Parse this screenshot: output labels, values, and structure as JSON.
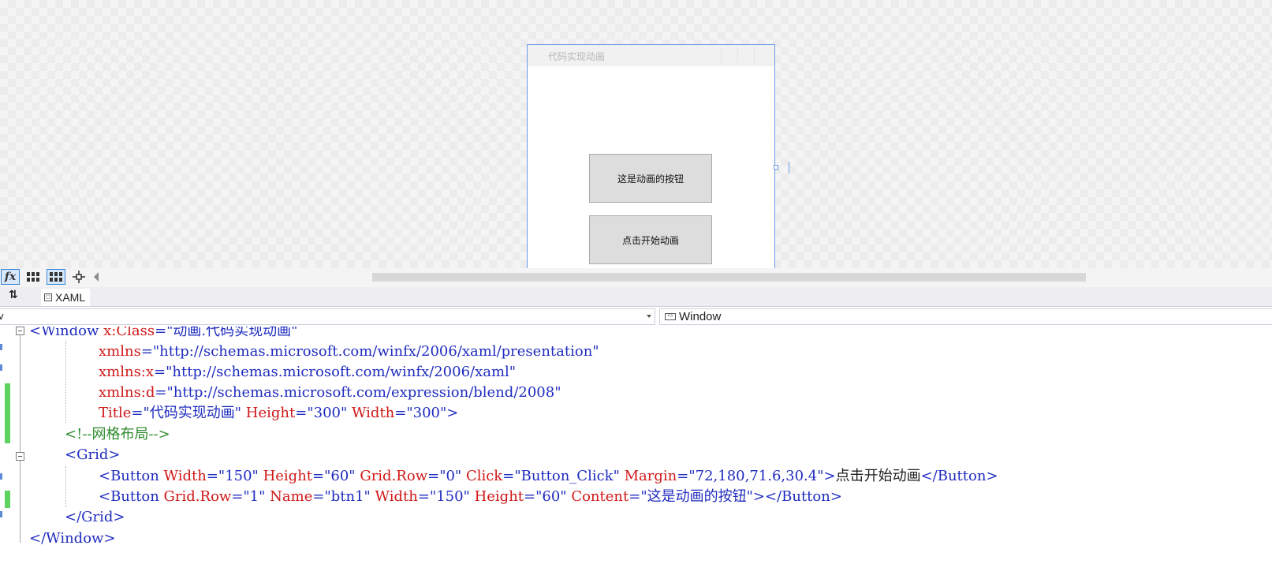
{
  "designer": {
    "window_title": "代码实现动画",
    "button_top_label": "这是动画的按钮",
    "button_bottom_label": "点击开始动画"
  },
  "zoombar": {
    "fx_label": "fx"
  },
  "tabs": {
    "swap_symbol": "⇅",
    "xaml_label": "XAML"
  },
  "navbar": {
    "left_value": "v",
    "right_value": "Window"
  },
  "code": {
    "l1": {
      "a": "<Window ",
      "b": "x:Class",
      "c": "=",
      "d": "\"动画.代码实现动画\""
    },
    "l2": {
      "a": "xmlns",
      "b": "=",
      "c": "\"http://schemas.microsoft.com/winfx/2006/xaml/presentation\""
    },
    "l3": {
      "a": "xmlns:x",
      "b": "=",
      "c": "\"http://schemas.microsoft.com/winfx/2006/xaml\""
    },
    "l4": {
      "a": "xmlns:d",
      "b": "=",
      "c": "\"http://schemas.microsoft.com/expression/blend/2008\""
    },
    "l5": {
      "a": "Title",
      "b": "=",
      "c": "\"代码实现动画\"",
      "d": " Height",
      "e": "=",
      "f": "\"300\"",
      "g": " Width",
      "h": "=",
      "i": "\"300\"",
      "j": ">"
    },
    "l6": {
      "a": "<!--网格布局-->"
    },
    "l7": {
      "a": "<Grid>"
    },
    "l8": {
      "a": "<Button ",
      "b": "Width",
      "c": "=",
      "d": "\"150\"",
      "e": " Height",
      "f": "=",
      "g": "\"60\"",
      "h": " Grid.Row",
      "i": "=",
      "j": "\"0\"",
      "k": " Click",
      "l": "=",
      "m": "\"Button_Click\"",
      "n": " Margin",
      "o": "=",
      "p": "\"72,180,71.6,30.4\"",
      "q": ">",
      "r": "点击开始动画",
      "s": "</Button>"
    },
    "l9": {
      "a": "<Button ",
      "b": "Grid.Row",
      "c": "=",
      "d": "\"1\"",
      "e": " Name",
      "f": "=",
      "g": "\"btn1\"",
      "h": " Width",
      "i": "=",
      "j": "\"150\"",
      "k": " Height",
      "l": "=",
      "m": "\"60\"",
      "n": " Content",
      "o": "=",
      "p": "\"这是动画的按钮\"",
      "q": "></Button>"
    },
    "l10": {
      "a": "</Grid>"
    },
    "l11": {
      "a": "</Window>"
    }
  }
}
